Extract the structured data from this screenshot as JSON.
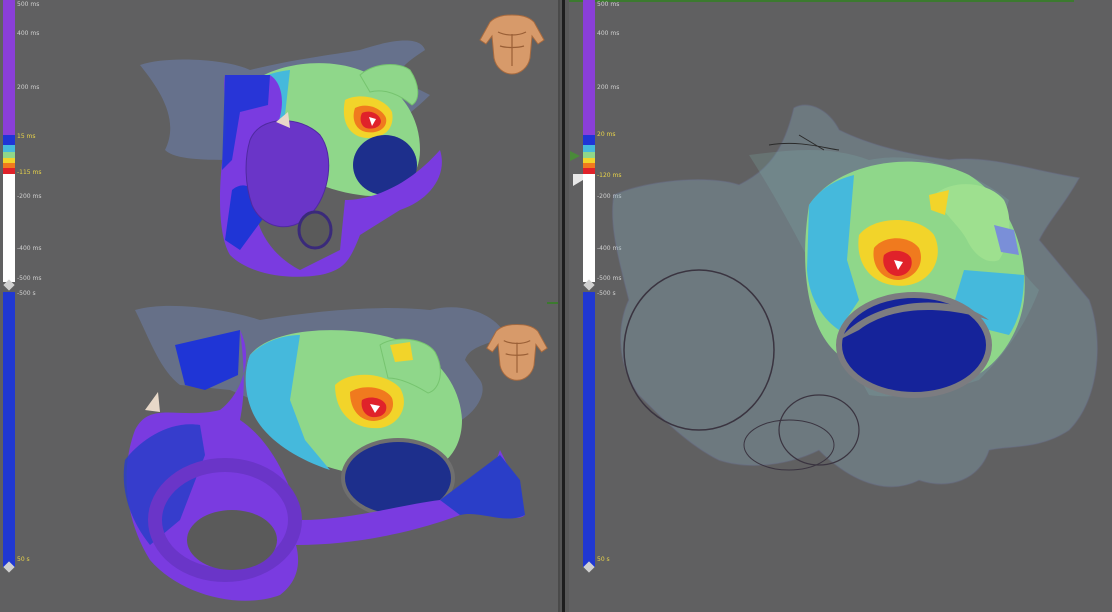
{
  "left_scale": {
    "top_label": "500 ms",
    "mid_labels": [
      "400 ms",
      "200 ms"
    ],
    "upper_threshold": "15 ms",
    "lower_threshold": "-115 ms",
    "lower_labels": [
      "-200 ms",
      "-400 ms",
      "-500 ms"
    ],
    "voltage_top": "-500 s",
    "voltage_bottom": "50 s"
  },
  "right_scale": {
    "top_label": "500 ms",
    "mid_labels": [
      "400 ms",
      "200 ms"
    ],
    "upper_threshold": "20 ms",
    "lower_threshold": "-120 ms",
    "lower_labels": [
      "-200 ms",
      "-400 ms",
      "-500 ms"
    ],
    "voltage_top": "-500 s",
    "voltage_bottom": "50 s"
  },
  "colors": {
    "late": "#8a3fd8",
    "blue": "#1f35d6",
    "cyan": "#45b9dc",
    "green": "#8fd78a",
    "yellow": "#f2d42a",
    "orange": "#f07a1e",
    "red": "#e0222a",
    "white": "#ffffff",
    "panel_bg": "#606061"
  },
  "icons": {
    "orientation": "torso-orientation-icon",
    "marker": "catheter-marker-icon"
  }
}
